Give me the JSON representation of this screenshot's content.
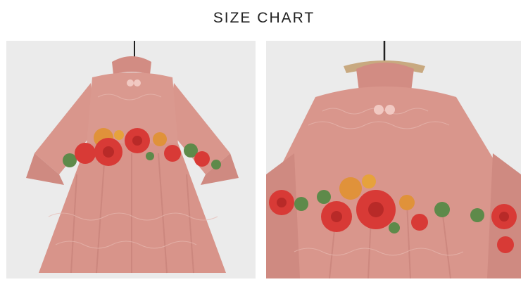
{
  "header": {
    "title": "SIZE CHART"
  },
  "photos": [
    {
      "subject": "dress-front-view"
    },
    {
      "subject": "dress-closeup-view"
    }
  ],
  "colors": {
    "background": "#ececec",
    "fabric": "#d9968c",
    "fabric_shadow": "#c47f77",
    "flower_red": "#d83a36",
    "flower_orange": "#e0923a",
    "leaf_green": "#5e8a4a",
    "hanger": "#1f1f1f"
  }
}
